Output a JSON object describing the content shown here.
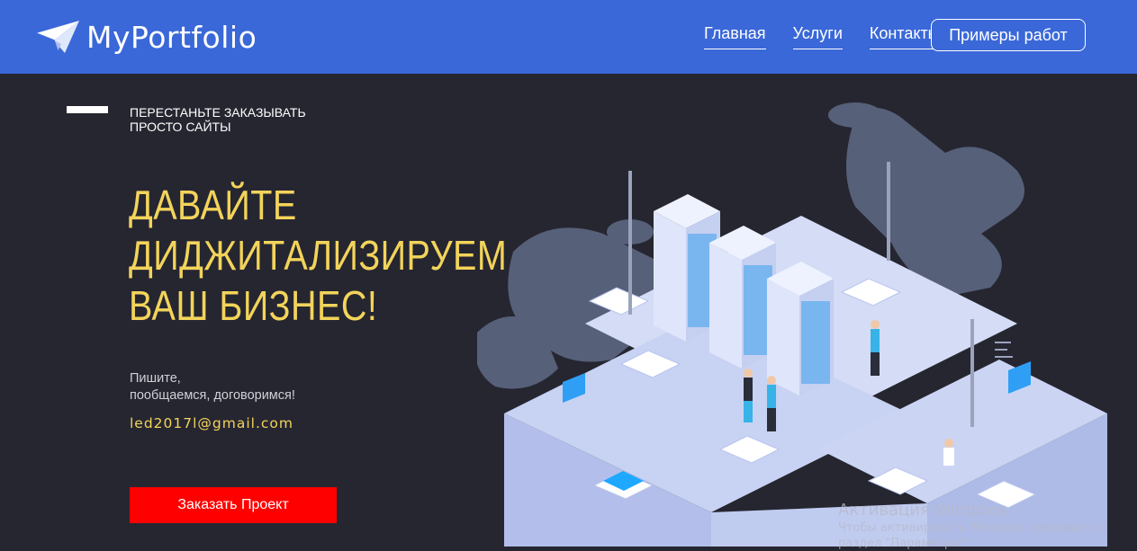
{
  "brand": {
    "name": "MyPortfolio",
    "logo_icon": "paper-plane-icon"
  },
  "nav": {
    "links": [
      "Главная",
      "Услуги",
      "Контакты"
    ],
    "cta_label": "Примеры работ"
  },
  "hero": {
    "tagline": [
      "ПЕРЕСТАНЬТЕ ЗАКАЗЫВАТЬ",
      "ПРОСТО САЙТЫ"
    ],
    "headline": [
      "ДАВАЙТЕ",
      "ДИДЖИТАЛИЗИРУЕМ",
      "ВАШ БИЗНЕС!"
    ],
    "write_us": [
      "Пишите,",
      "пообщаемся, договоримся!"
    ],
    "email": "led2017l@gmail.com",
    "order_button": "Заказать Проект",
    "illustration": "isometric-data-center-illustration"
  },
  "watermark": {
    "title": "Активация Windows",
    "subtitle": "Чтобы активировать Windows, перейдите в",
    "subtitle2": "раздел \"Параметры\"."
  },
  "colors": {
    "header_bg": "#3a68d8",
    "page_bg": "#262631",
    "accent_yellow": "#f3d45a",
    "button_red": "#fe0000"
  }
}
